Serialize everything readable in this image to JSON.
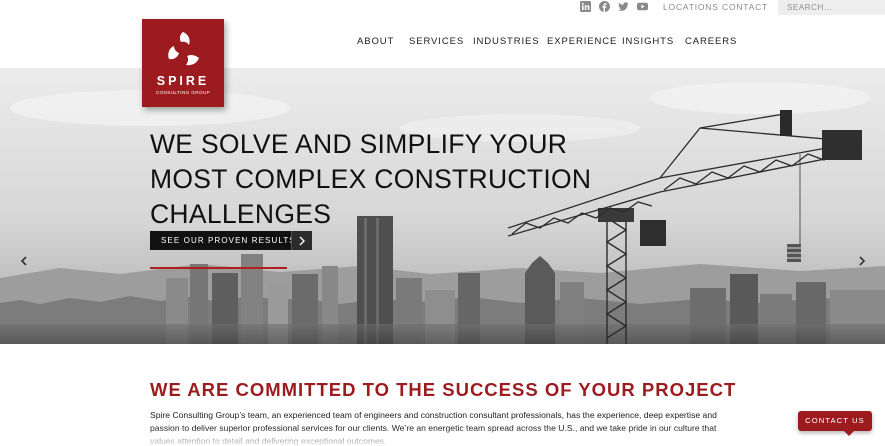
{
  "utility": {
    "social": [
      {
        "name": "linkedin-icon"
      },
      {
        "name": "facebook-icon"
      },
      {
        "name": "twitter-icon"
      },
      {
        "name": "youtube-icon"
      }
    ],
    "locations_label": "LOCATIONS",
    "contact_label": "CONTACT",
    "search_placeholder": "SEARCH..."
  },
  "logo": {
    "wordmark": "SPIRE",
    "subline": "CONSULTING GROUP"
  },
  "nav": {
    "items": [
      {
        "label": "ABOUT"
      },
      {
        "label": "SERVICES"
      },
      {
        "label": "INDUSTRIES"
      },
      {
        "label": "EXPERIENCE"
      },
      {
        "label": "INSIGHTS"
      },
      {
        "label": "CAREERS"
      }
    ]
  },
  "hero": {
    "headline_lines": [
      "WE SOLVE AND SIMPLIFY YOUR",
      "MOST COMPLEX CONSTRUCTION",
      "CHALLENGES"
    ],
    "cta_label": "SEE OUR PROVEN RESULTS"
  },
  "section": {
    "title": "WE ARE COMMITTED TO THE SUCCESS OF YOUR PROJECT",
    "body_lines": [
      "Spire Consulting Group’s team, an experienced team of engineers and construction consultant professionals, has the experience, deep expertise and",
      "passion to deliver superior professional services for our clients. We’re an energetic team spread across the U.S., and we take pride in our culture that",
      "values attention to detail and delivering exceptional outcomes."
    ]
  },
  "floating": {
    "contact_us_label": "CONTACT US"
  },
  "colors": {
    "brand_red": "#9b1b1e",
    "accent_red": "#b01e22",
    "text_dark": "#111111"
  }
}
